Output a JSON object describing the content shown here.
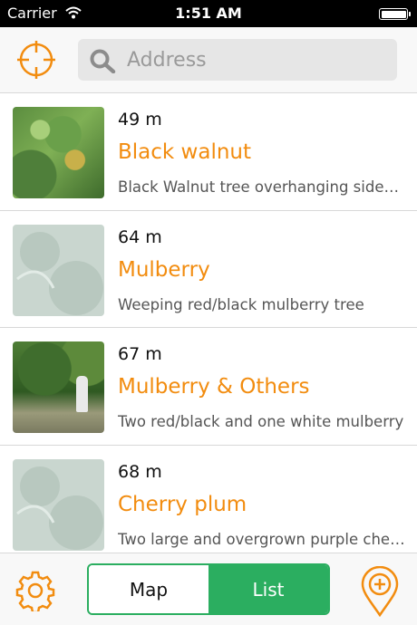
{
  "status_bar": {
    "carrier": "Carrier",
    "time": "1:51 AM",
    "wifi_icon": "wifi-icon",
    "battery_icon": "battery-icon"
  },
  "search": {
    "placeholder": "Address",
    "value": "",
    "locate_icon": "crosshair-icon",
    "search_icon": "search-icon"
  },
  "colors": {
    "accent": "#f28c0f",
    "green": "#2bae60"
  },
  "items": [
    {
      "distance": "49 m",
      "name": "Black walnut",
      "description": "Black Walnut tree overhanging sidewalk",
      "thumb": "walnut"
    },
    {
      "distance": "64 m",
      "name": "Mulberry",
      "description": "Weeping red/black mulberry tree",
      "thumb": "placeholder"
    },
    {
      "distance": "67 m",
      "name": "Mulberry & Others",
      "description": "Two red/black and one white mulberry",
      "thumb": "park"
    },
    {
      "distance": "68 m",
      "name": "Cherry plum",
      "description": "Two large and overgrown purple cherry plums",
      "thumb": "placeholder"
    }
  ],
  "tab_bar": {
    "map_label": "Map",
    "list_label": "List",
    "selected": "List",
    "settings_icon": "gear-icon",
    "add_icon": "add-location-icon"
  }
}
